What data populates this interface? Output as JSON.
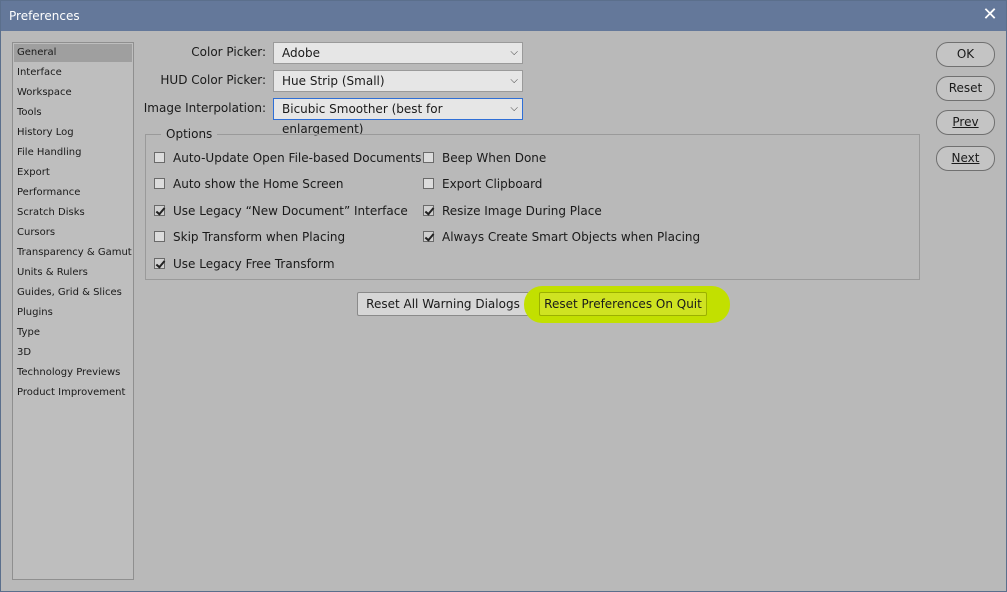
{
  "window": {
    "title": "Preferences"
  },
  "sidebar": {
    "items": [
      {
        "label": "General",
        "selected": true
      },
      {
        "label": "Interface"
      },
      {
        "label": "Workspace"
      },
      {
        "label": "Tools"
      },
      {
        "label": "History Log"
      },
      {
        "label": "File Handling"
      },
      {
        "label": "Export"
      },
      {
        "label": "Performance"
      },
      {
        "label": "Scratch Disks"
      },
      {
        "label": "Cursors"
      },
      {
        "label": "Transparency & Gamut"
      },
      {
        "label": "Units & Rulers"
      },
      {
        "label": "Guides, Grid & Slices"
      },
      {
        "label": "Plugins"
      },
      {
        "label": "Type"
      },
      {
        "label": "3D"
      },
      {
        "label": "Technology Previews"
      },
      {
        "label": "Product Improvement"
      }
    ]
  },
  "settings": {
    "color_picker": {
      "label": "Color Picker:",
      "value": "Adobe"
    },
    "hud_color_picker": {
      "label": "HUD Color Picker:",
      "value": "Hue Strip (Small)"
    },
    "image_interpolation": {
      "label": "Image Interpolation:",
      "value": "Bicubic Smoother (best for enlargement)"
    }
  },
  "options": {
    "title": "Options",
    "left": [
      {
        "label": "Auto-Update Open File-based Documents",
        "checked": false
      },
      {
        "label": "Auto show the Home Screen",
        "checked": false
      },
      {
        "label": "Use Legacy “New Document” Interface",
        "checked": true
      },
      {
        "label": "Skip Transform when Placing",
        "checked": false
      },
      {
        "label": "Use Legacy Free Transform",
        "checked": true
      }
    ],
    "right": [
      {
        "label": "Beep When Done",
        "checked": false
      },
      {
        "label": "Export Clipboard",
        "checked": false
      },
      {
        "label": "Resize Image During Place",
        "checked": true
      },
      {
        "label": "Always Create Smart Objects when Placing",
        "checked": true
      }
    ]
  },
  "buttons": {
    "reset_warnings": "Reset All Warning Dialogs",
    "reset_prefs": "Reset Preferences On Quit",
    "ok": "OK",
    "reset": "Reset",
    "prev": "Prev",
    "next": "Next"
  },
  "colors": {
    "titlebar": "#64789a",
    "background": "#b9b9b9",
    "highlight": "#c2e000"
  }
}
